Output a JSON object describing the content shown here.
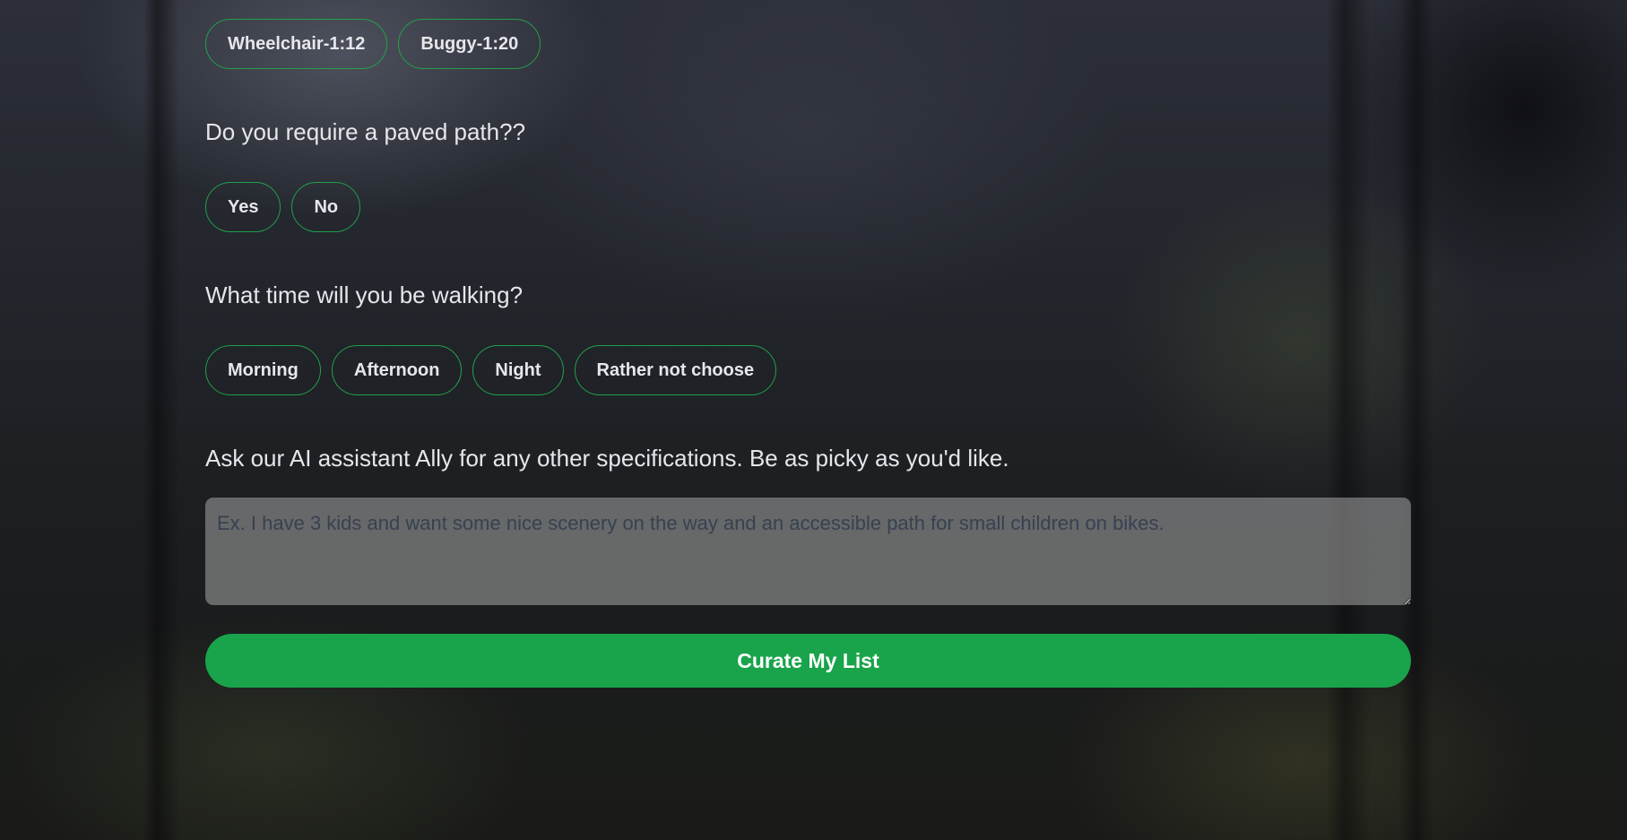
{
  "mobility": {
    "options": [
      "Wheelchair-1:12",
      "Buggy-1:20"
    ]
  },
  "paved": {
    "question": "Do you require a paved path??",
    "options": [
      "Yes",
      "No"
    ]
  },
  "time": {
    "question": "What time will you be walking?",
    "options": [
      "Morning",
      "Afternoon",
      "Night",
      "Rather not choose"
    ]
  },
  "assistant": {
    "question": "Ask our AI assistant Ally for any other specifications. Be as picky as you'd like.",
    "placeholder": "Ex. I have 3 kids and want some nice scenery on the way and an accessible path for small children on bikes.",
    "value": ""
  },
  "submit": {
    "label": "Curate My List"
  },
  "colors": {
    "accent": "#19a44b",
    "pill_border": "#22a04b"
  }
}
